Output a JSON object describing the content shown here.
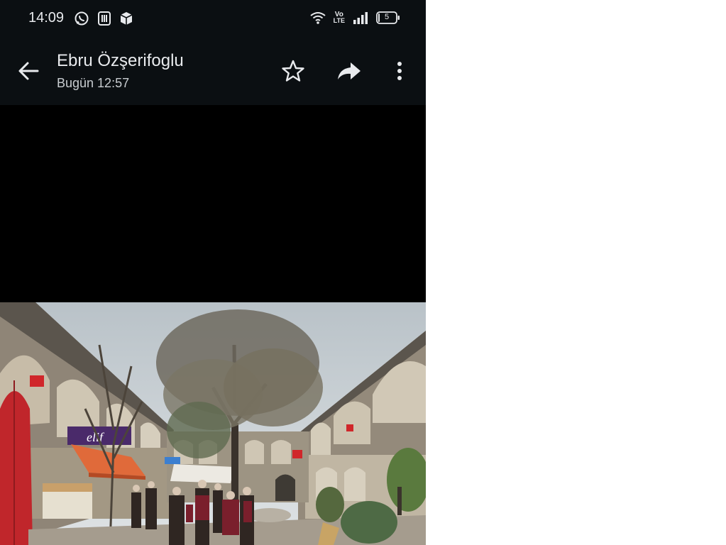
{
  "status_bar": {
    "time": "14:09",
    "battery_level": "5",
    "icons_left": [
      "whatsapp-icon",
      "sim-icon",
      "box-icon"
    ],
    "icons_right": [
      "wifi-icon",
      "volte-icon",
      "signal-icon",
      "battery-icon"
    ],
    "volte_top": "Vo",
    "volte_bottom": "LTE"
  },
  "header": {
    "contact_name": "Ebru Özşerifoglu",
    "timestamp": "Bugün 12:57",
    "actions": [
      "back-icon",
      "star-icon",
      "share-icon",
      "more-vert-icon"
    ]
  },
  "photo": {
    "sign_text": "elif",
    "scene": "courtyard"
  },
  "colors": {
    "bar_bg": "#0b0f12",
    "text_primary": "#e8eaed",
    "text_secondary": "#c8ccd0",
    "umbrella_red": "#c0262b",
    "awning_orange": "#e06a3a",
    "sign_purple": "#4a2a6a"
  }
}
